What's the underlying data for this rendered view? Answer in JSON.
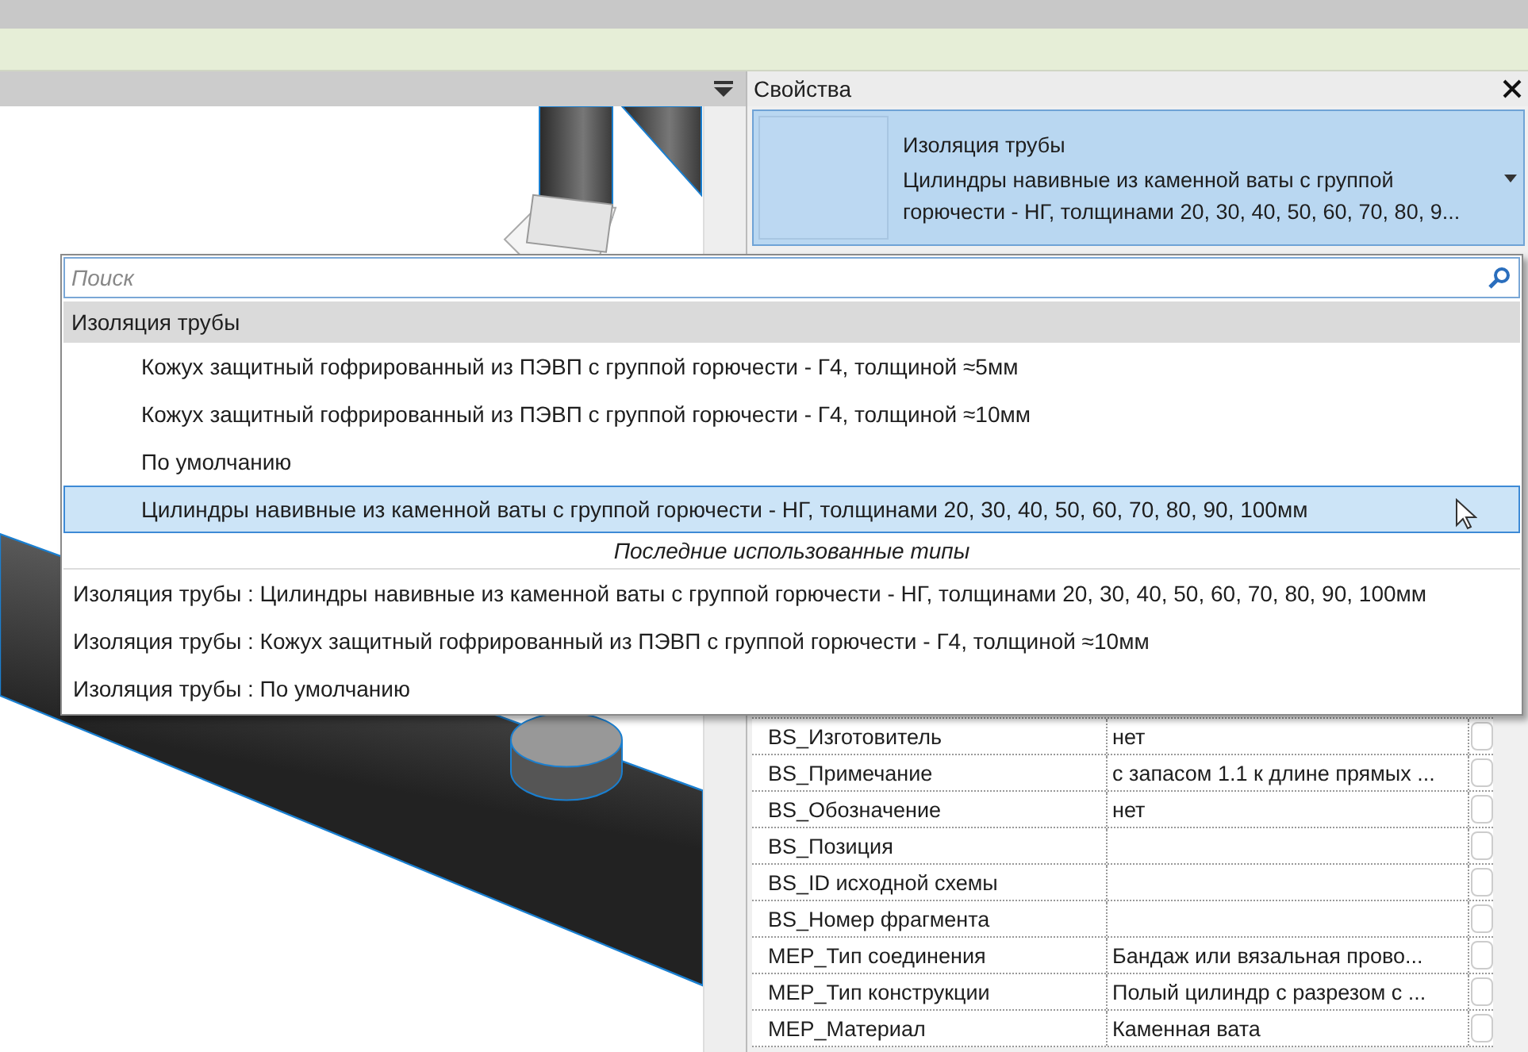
{
  "properties": {
    "title": "Свойства",
    "type_selector": {
      "family": "Изоляция трубы",
      "type": "Цилиндры навивные из каменной ваты с группой горючести - НГ, толщинами 20, 30, 40, 50, 60, 70, 80, 9..."
    },
    "parameters": [
      {
        "name": "BS_Изготовитель",
        "value": "нет"
      },
      {
        "name": "BS_Примечание",
        "value": "с запасом 1.1 к длине прямых ..."
      },
      {
        "name": "BS_Обозначение",
        "value": "нет"
      },
      {
        "name": "BS_Позиция"
      },
      {
        "name": "BS_ID исходной схемы"
      },
      {
        "name": "BS_Номер фрагмента"
      },
      {
        "name": "MEP_Тип соединения",
        "value": "Бандаж или вязальная прово..."
      },
      {
        "name": "MEP_Тип конструкции",
        "value": "Полый цилиндр с разрезом с ..."
      },
      {
        "name": "MEP_Материал",
        "value": "Каменная вата"
      }
    ]
  },
  "type_dropdown": {
    "search": {
      "placeholder": "Поиск"
    },
    "group": {
      "name": "Изоляция трубы",
      "items": [
        {
          "label": "Кожух защитный гофрированный из ПЭВП с группой горючести - Г4, толщиной ≈5мм",
          "selected": false
        },
        {
          "label": "Кожух защитный гофрированный из ПЭВП с группой горючести - Г4, толщиной ≈10мм",
          "selected": false
        },
        {
          "label": "По умолчанию",
          "selected": false
        },
        {
          "label": "Цилиндры навивные из каменной ваты с группой горючести - НГ, толщинами 20, 30, 40, 50, 60, 70, 80, 90, 100мм",
          "selected": true
        }
      ]
    },
    "recent_title": "Последние использованные типы",
    "recent": [
      "Изоляция трубы : Цилиндры навивные из каменной ваты с группой горючести - НГ, толщинами 20, 30, 40, 50, 60, 70, 80, 90, 100мм",
      "Изоляция трубы : Кожух защитный гофрированный из ПЭВП с группой горючести - Г4, толщиной ≈10мм",
      "Изоляция трубы : По умолчанию"
    ]
  }
}
